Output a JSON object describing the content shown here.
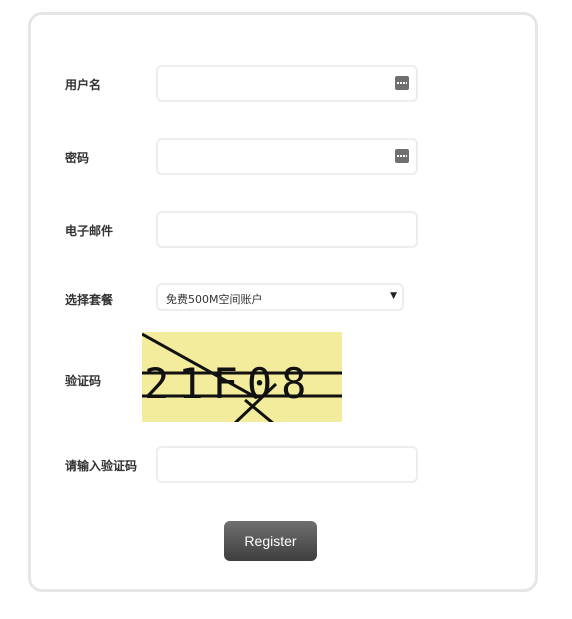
{
  "form": {
    "username_label": "用户名",
    "password_label": "密码",
    "email_label": "电子邮件",
    "plan_label": "选择套餐",
    "plan_selected": "免费500M空间账户",
    "captcha_label": "验证码",
    "captcha_text": "21F08",
    "captcha_input_label": "请输入验证码",
    "register_label": "Register"
  },
  "colors": {
    "captcha_bg": "#f2ec9c",
    "button_bg": "#4f4f4f",
    "border": "#e6e6e6"
  }
}
